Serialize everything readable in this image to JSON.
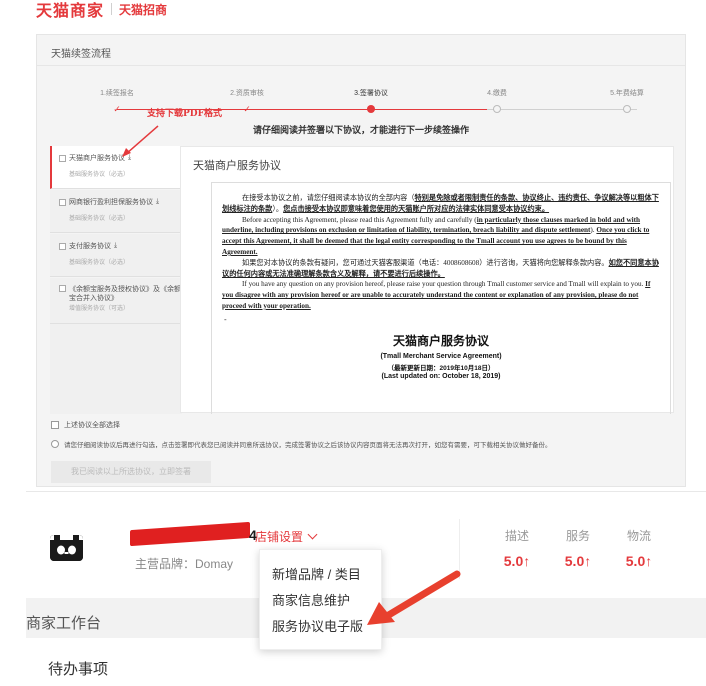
{
  "brand": {
    "name": "天猫商家",
    "sub": "天猫招商"
  },
  "flow": {
    "title": "天猫续签流程",
    "steps": [
      {
        "label": "1.续签报名",
        "state": "done"
      },
      {
        "label": "2.资质审核",
        "state": "done"
      },
      {
        "label": "3.签署协议",
        "state": "current"
      },
      {
        "label": "4.缴费",
        "state": "pending"
      },
      {
        "label": "5.年费结算",
        "state": "pending"
      }
    ],
    "notice": "请仔细阅读并签署以下协议，才能进行下一步续签操作"
  },
  "callout": "支持下载PDF格式",
  "agreements": [
    {
      "name": "天猫商户服务协议",
      "sub": "基础服务协议（必选）",
      "download": "⤓"
    },
    {
      "name": "网商银行盈利担保服务协议",
      "sub": "基础服务协议（必选）",
      "download": "⤓"
    },
    {
      "name": "支付服务协议",
      "sub": "基础服务协议（必选）",
      "download": "⤓"
    },
    {
      "name": "《余额宝服务及授权协议》及《余额宝合并入协议》",
      "sub": "增值服务协议（可选）",
      "download": ""
    }
  ],
  "viewer": {
    "title": "天猫商户服务协议",
    "p1_a": "在接受本协议之前，请您仔细阅读本协议的全部内容（",
    "p1_b": "特别是免除或者限制责任的条款、协议终止、违约责任、争议解决等以粗体下划线标注的条款",
    "p1_c": "）。",
    "p1_d": "您点击接受本协议即意味着您使用的天猫账户所对应的法律实体同意受本协议约束。",
    "p2_a": "Before accepting this Agreement, please read this Agreement fully and carefully (",
    "p2_b": "in particularly those clauses marked in bold and with underline, including provisions on exclusion or limitation of liability, termination, breach liability and dispute settlement",
    "p2_c": "). ",
    "p2_d": "Once you click to accept this Agreement, it shall be deemed that the legal entity corresponding to the Tmall account you use agrees to be bound by this Agreement.",
    "p3_a": "如果您对本协议的条款有疑问，您可通过天猫客服渠道（电话：4008608608）进行咨询，天猫将向您解释条款内容。",
    "p3_b": "如您不同意本协议的任何内容或无法准确理解条款含义及解释，请不要进行后续操作。",
    "p4_a": "If you have any question on any provision hereof, please raise your question through Tmall customer service and Tmall will explain to you. ",
    "p4_b": "If you disagree with any provision hereof or are unable to accurately understand the content or explanation of any provision, please do not proceed with your operation.",
    "dash": "-",
    "doc_title": "天猫商户服务协议",
    "doc_title_en": "(Tmall Merchant Service Agreement)",
    "updated_cn": "（最新更新日期：2019年10月18日）",
    "updated_en": "(Last updated on: October 18, 2019)"
  },
  "agree_all": "上述协议全部选择",
  "tip": "请您仔细阅读协议后再进行勾选，点击签署即代表您已阅读并同意所选协议，完成签署协议之后该协议内容页面将无法再次打开，如您有需要，可下载相关协议做好备份。",
  "submit": "我已阅读以上所选协议，立即签署",
  "shop": {
    "name_suffix": "4",
    "settings": "店铺设置",
    "main_brand": "主营品牌：Domay",
    "metrics": [
      {
        "label": "描述",
        "value": "5.0↑"
      },
      {
        "label": "服务",
        "value": "5.0↑"
      },
      {
        "label": "物流",
        "value": "5.0↑"
      }
    ]
  },
  "dropdown": [
    "新增品牌 / 类目",
    "商家信息维护",
    "服务协议电子版"
  ],
  "workbench": "商家工作台",
  "todo": "待办事项",
  "colors": {
    "accent": "#e4393c",
    "redact": "#e02020"
  }
}
